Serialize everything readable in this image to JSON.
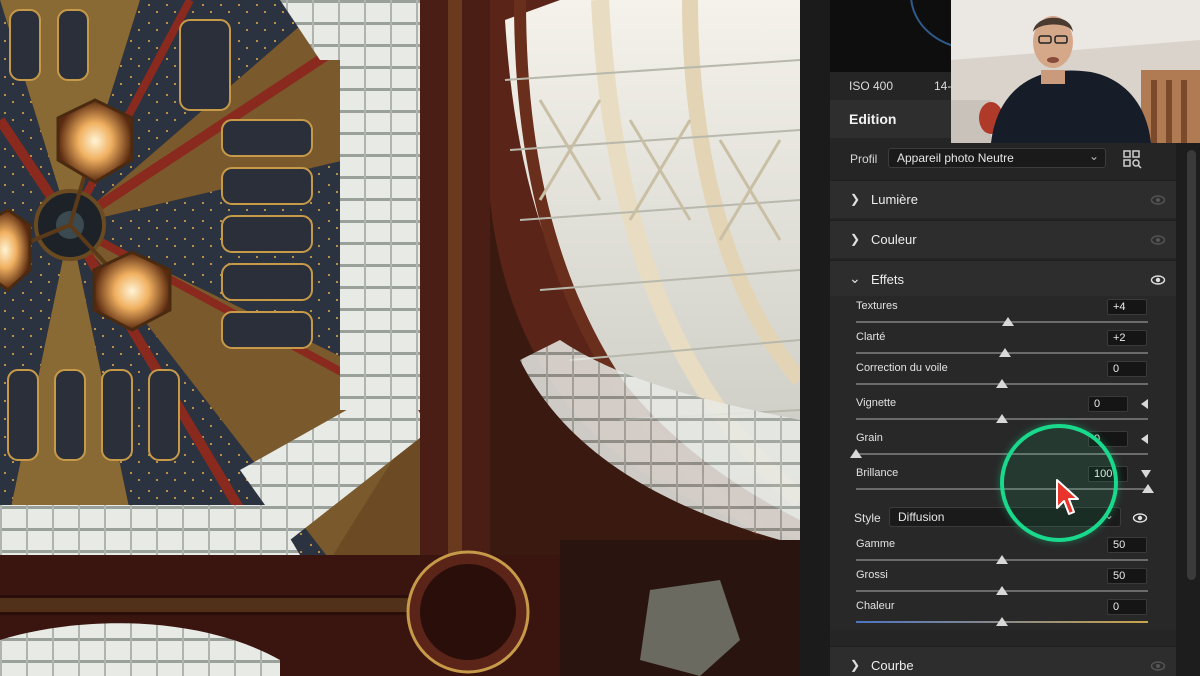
{
  "info": {
    "iso": "ISO 400",
    "focal": "14-"
  },
  "edition": {
    "title": "Edition"
  },
  "profil": {
    "label": "Profil",
    "value": "Appareil photo Neutre"
  },
  "sections": {
    "lumiere": "Lumière",
    "couleur": "Couleur",
    "effets": "Effets",
    "courbe": "Courbe"
  },
  "effets": {
    "textures": {
      "label": "Textures",
      "value": "+4",
      "level": 4,
      "min": -100,
      "max": 100
    },
    "clarte": {
      "label": "Clarté",
      "value": "+2",
      "level": 2,
      "min": -100,
      "max": 100
    },
    "voile": {
      "label": "Correction du voile",
      "value": "0",
      "level": 0,
      "min": -100,
      "max": 100
    },
    "vignette": {
      "label": "Vignette",
      "value": "0",
      "level": 0,
      "min": -100,
      "max": 100
    },
    "grain": {
      "label": "Grain",
      "value": "0",
      "level": 0,
      "min": 0,
      "max": 100
    },
    "brillance": {
      "label": "Brillance",
      "value": "100",
      "level": 100,
      "min": 0,
      "max": 100
    },
    "style": {
      "label": "Style",
      "value": "Diffusion"
    },
    "gamme": {
      "label": "Gamme",
      "value": "50",
      "level": 50,
      "min": 0,
      "max": 100
    },
    "grossi": {
      "label": "Grossi",
      "value": "50",
      "level": 50,
      "min": 0,
      "max": 100
    },
    "chaleur": {
      "label": "Chaleur",
      "value": "0",
      "level": 0,
      "min": -100,
      "max": 100
    }
  },
  "colors": {
    "panel": "#252525",
    "highlight_ring": "#19d98c",
    "cursor": "#e8342a"
  },
  "icons": {
    "expand": "chevron-right-icon",
    "collapse": "chevron-down-icon",
    "visibility": "eye-icon",
    "browse": "profile-browser-icon",
    "pointer": "mouse-pointer-icon"
  }
}
